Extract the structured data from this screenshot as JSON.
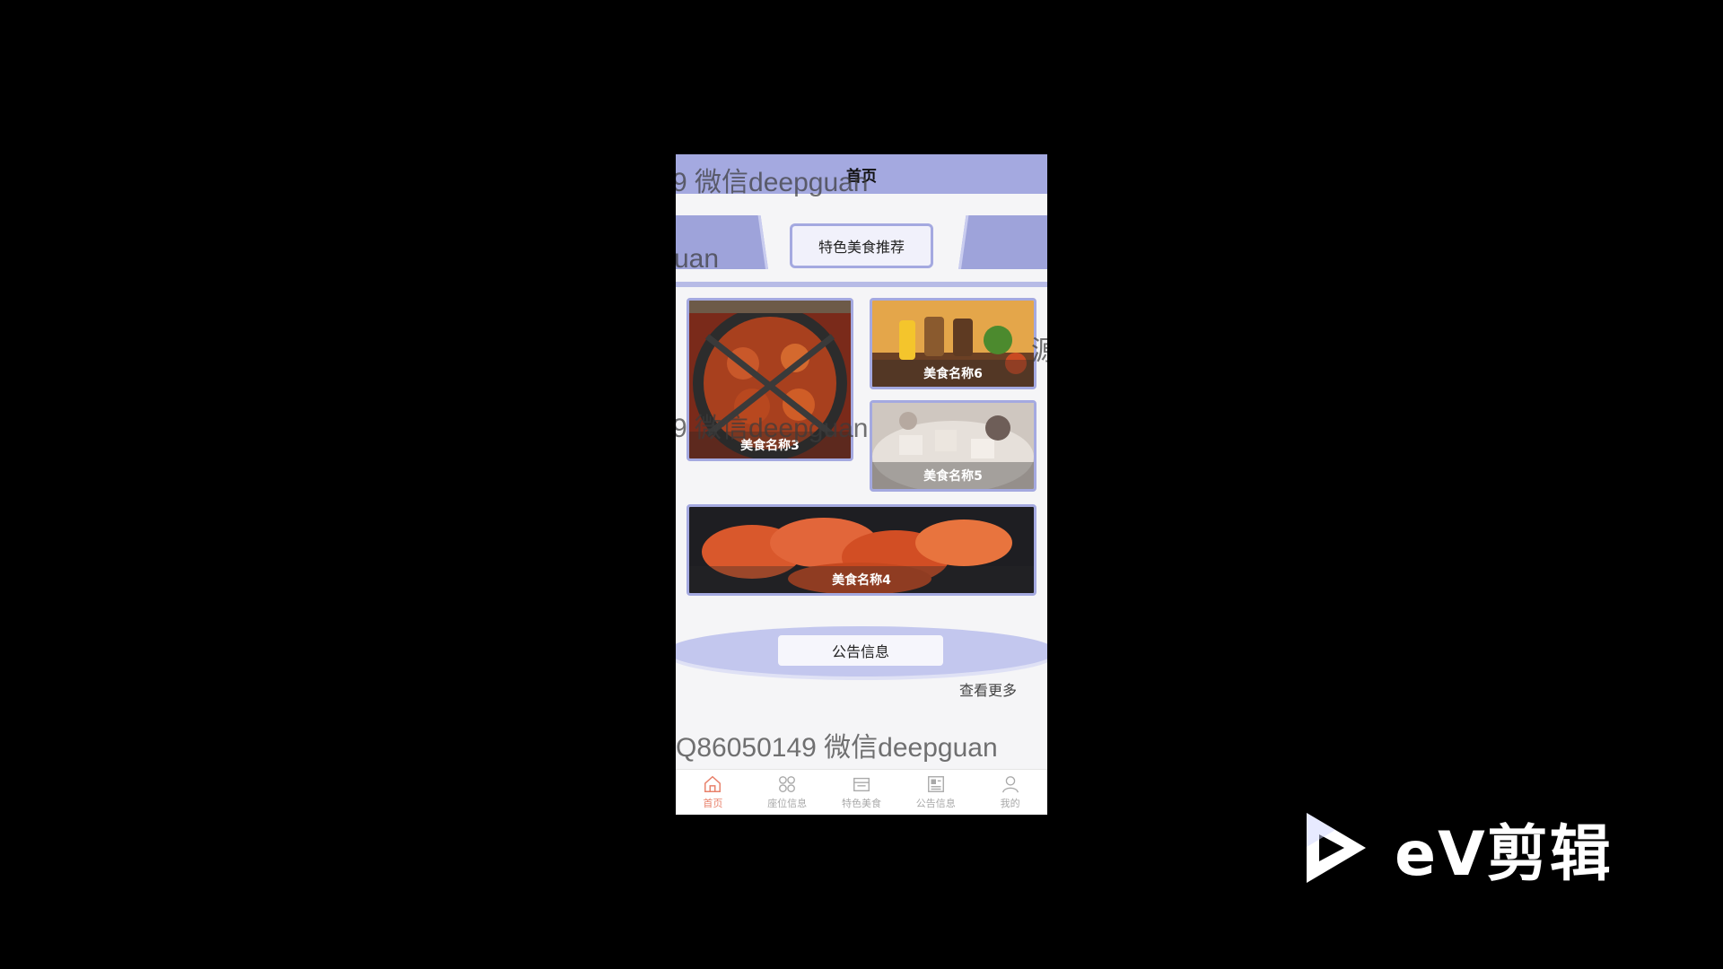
{
  "header": {
    "title": "首页"
  },
  "food_section": {
    "title": "特色美食推荐",
    "items": [
      {
        "label": "美食名称3"
      },
      {
        "label": "美食名称6"
      },
      {
        "label": "美食名称5"
      },
      {
        "label": "美食名称4"
      }
    ]
  },
  "notice_section": {
    "title": "公告信息",
    "more_label": "查看更多"
  },
  "watermarks": [
    "9 微信deepguan",
    "uan",
    "9 微信deepguan",
    "源",
    "Q86050149 微信deepguan"
  ],
  "tabbar": {
    "items": [
      {
        "label": "首页",
        "icon": "home-icon",
        "active": true
      },
      {
        "label": "座位信息",
        "icon": "grid-icon",
        "active": false
      },
      {
        "label": "特色美食",
        "icon": "calendar-icon",
        "active": false
      },
      {
        "label": "公告信息",
        "icon": "news-icon",
        "active": false
      },
      {
        "label": "我的",
        "icon": "user-icon",
        "active": false
      }
    ]
  },
  "brand": {
    "text": "eV剪辑"
  },
  "colors": {
    "accent": "#a4a9e0",
    "tab_active": "#e8806a",
    "background": "#000000"
  }
}
